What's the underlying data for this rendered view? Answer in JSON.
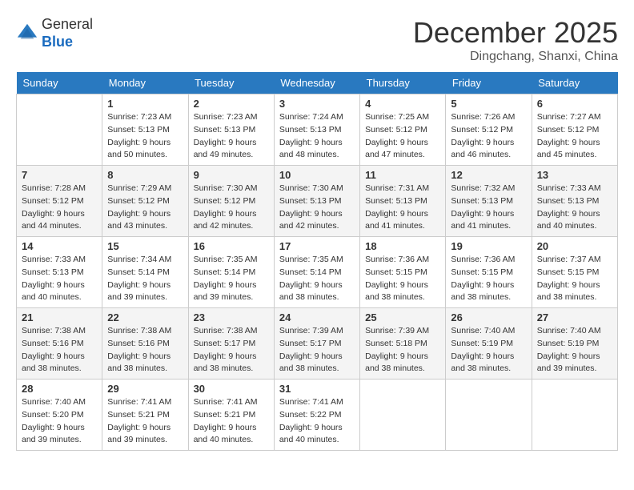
{
  "header": {
    "logo_line1": "General",
    "logo_line2": "Blue",
    "month": "December 2025",
    "location": "Dingchang, Shanxi, China"
  },
  "weekdays": [
    "Sunday",
    "Monday",
    "Tuesday",
    "Wednesday",
    "Thursday",
    "Friday",
    "Saturday"
  ],
  "weeks": [
    [
      {
        "day": "",
        "sunrise": "",
        "sunset": "",
        "daylight": ""
      },
      {
        "day": "1",
        "sunrise": "Sunrise: 7:23 AM",
        "sunset": "Sunset: 5:13 PM",
        "daylight": "Daylight: 9 hours and 50 minutes."
      },
      {
        "day": "2",
        "sunrise": "Sunrise: 7:23 AM",
        "sunset": "Sunset: 5:13 PM",
        "daylight": "Daylight: 9 hours and 49 minutes."
      },
      {
        "day": "3",
        "sunrise": "Sunrise: 7:24 AM",
        "sunset": "Sunset: 5:13 PM",
        "daylight": "Daylight: 9 hours and 48 minutes."
      },
      {
        "day": "4",
        "sunrise": "Sunrise: 7:25 AM",
        "sunset": "Sunset: 5:12 PM",
        "daylight": "Daylight: 9 hours and 47 minutes."
      },
      {
        "day": "5",
        "sunrise": "Sunrise: 7:26 AM",
        "sunset": "Sunset: 5:12 PM",
        "daylight": "Daylight: 9 hours and 46 minutes."
      },
      {
        "day": "6",
        "sunrise": "Sunrise: 7:27 AM",
        "sunset": "Sunset: 5:12 PM",
        "daylight": "Daylight: 9 hours and 45 minutes."
      }
    ],
    [
      {
        "day": "7",
        "sunrise": "Sunrise: 7:28 AM",
        "sunset": "Sunset: 5:12 PM",
        "daylight": "Daylight: 9 hours and 44 minutes."
      },
      {
        "day": "8",
        "sunrise": "Sunrise: 7:29 AM",
        "sunset": "Sunset: 5:12 PM",
        "daylight": "Daylight: 9 hours and 43 minutes."
      },
      {
        "day": "9",
        "sunrise": "Sunrise: 7:30 AM",
        "sunset": "Sunset: 5:12 PM",
        "daylight": "Daylight: 9 hours and 42 minutes."
      },
      {
        "day": "10",
        "sunrise": "Sunrise: 7:30 AM",
        "sunset": "Sunset: 5:13 PM",
        "daylight": "Daylight: 9 hours and 42 minutes."
      },
      {
        "day": "11",
        "sunrise": "Sunrise: 7:31 AM",
        "sunset": "Sunset: 5:13 PM",
        "daylight": "Daylight: 9 hours and 41 minutes."
      },
      {
        "day": "12",
        "sunrise": "Sunrise: 7:32 AM",
        "sunset": "Sunset: 5:13 PM",
        "daylight": "Daylight: 9 hours and 41 minutes."
      },
      {
        "day": "13",
        "sunrise": "Sunrise: 7:33 AM",
        "sunset": "Sunset: 5:13 PM",
        "daylight": "Daylight: 9 hours and 40 minutes."
      }
    ],
    [
      {
        "day": "14",
        "sunrise": "Sunrise: 7:33 AM",
        "sunset": "Sunset: 5:13 PM",
        "daylight": "Daylight: 9 hours and 40 minutes."
      },
      {
        "day": "15",
        "sunrise": "Sunrise: 7:34 AM",
        "sunset": "Sunset: 5:14 PM",
        "daylight": "Daylight: 9 hours and 39 minutes."
      },
      {
        "day": "16",
        "sunrise": "Sunrise: 7:35 AM",
        "sunset": "Sunset: 5:14 PM",
        "daylight": "Daylight: 9 hours and 39 minutes."
      },
      {
        "day": "17",
        "sunrise": "Sunrise: 7:35 AM",
        "sunset": "Sunset: 5:14 PM",
        "daylight": "Daylight: 9 hours and 38 minutes."
      },
      {
        "day": "18",
        "sunrise": "Sunrise: 7:36 AM",
        "sunset": "Sunset: 5:15 PM",
        "daylight": "Daylight: 9 hours and 38 minutes."
      },
      {
        "day": "19",
        "sunrise": "Sunrise: 7:36 AM",
        "sunset": "Sunset: 5:15 PM",
        "daylight": "Daylight: 9 hours and 38 minutes."
      },
      {
        "day": "20",
        "sunrise": "Sunrise: 7:37 AM",
        "sunset": "Sunset: 5:15 PM",
        "daylight": "Daylight: 9 hours and 38 minutes."
      }
    ],
    [
      {
        "day": "21",
        "sunrise": "Sunrise: 7:38 AM",
        "sunset": "Sunset: 5:16 PM",
        "daylight": "Daylight: 9 hours and 38 minutes."
      },
      {
        "day": "22",
        "sunrise": "Sunrise: 7:38 AM",
        "sunset": "Sunset: 5:16 PM",
        "daylight": "Daylight: 9 hours and 38 minutes."
      },
      {
        "day": "23",
        "sunrise": "Sunrise: 7:38 AM",
        "sunset": "Sunset: 5:17 PM",
        "daylight": "Daylight: 9 hours and 38 minutes."
      },
      {
        "day": "24",
        "sunrise": "Sunrise: 7:39 AM",
        "sunset": "Sunset: 5:17 PM",
        "daylight": "Daylight: 9 hours and 38 minutes."
      },
      {
        "day": "25",
        "sunrise": "Sunrise: 7:39 AM",
        "sunset": "Sunset: 5:18 PM",
        "daylight": "Daylight: 9 hours and 38 minutes."
      },
      {
        "day": "26",
        "sunrise": "Sunrise: 7:40 AM",
        "sunset": "Sunset: 5:19 PM",
        "daylight": "Daylight: 9 hours and 38 minutes."
      },
      {
        "day": "27",
        "sunrise": "Sunrise: 7:40 AM",
        "sunset": "Sunset: 5:19 PM",
        "daylight": "Daylight: 9 hours and 39 minutes."
      }
    ],
    [
      {
        "day": "28",
        "sunrise": "Sunrise: 7:40 AM",
        "sunset": "Sunset: 5:20 PM",
        "daylight": "Daylight: 9 hours and 39 minutes."
      },
      {
        "day": "29",
        "sunrise": "Sunrise: 7:41 AM",
        "sunset": "Sunset: 5:21 PM",
        "daylight": "Daylight: 9 hours and 39 minutes."
      },
      {
        "day": "30",
        "sunrise": "Sunrise: 7:41 AM",
        "sunset": "Sunset: 5:21 PM",
        "daylight": "Daylight: 9 hours and 40 minutes."
      },
      {
        "day": "31",
        "sunrise": "Sunrise: 7:41 AM",
        "sunset": "Sunset: 5:22 PM",
        "daylight": "Daylight: 9 hours and 40 minutes."
      },
      {
        "day": "",
        "sunrise": "",
        "sunset": "",
        "daylight": ""
      },
      {
        "day": "",
        "sunrise": "",
        "sunset": "",
        "daylight": ""
      },
      {
        "day": "",
        "sunrise": "",
        "sunset": "",
        "daylight": ""
      }
    ]
  ]
}
